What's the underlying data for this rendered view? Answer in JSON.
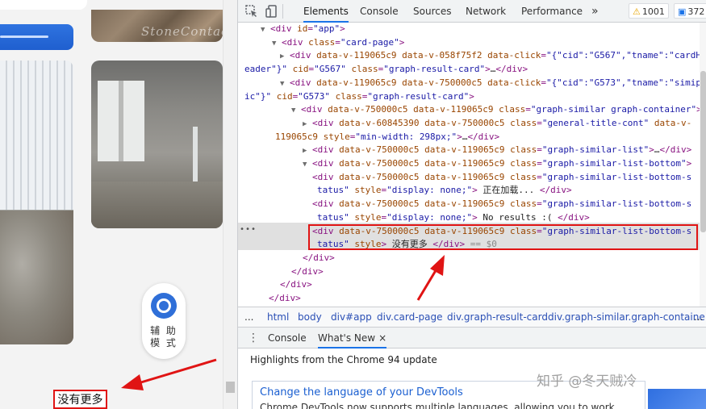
{
  "page": {
    "watermark_top": "StoneContact",
    "assist_label": "辅 助\n模 式",
    "no_more": "没有更多"
  },
  "devtools": {
    "tabs": [
      "Elements",
      "Console",
      "Sources",
      "Network",
      "Performance"
    ],
    "more_tabs": "»",
    "warnings": "1001",
    "messages": "372",
    "crumbs": [
      "...",
      "html",
      "body",
      "div#app",
      "div.card-page",
      "div.graph-result-card",
      "div.graph-similar.graph-containe",
      "..."
    ],
    "drawer_tabs": [
      "Console",
      "What's New"
    ],
    "drawer_close": "×",
    "highlights": "Highlights from the Chrome 94 update",
    "card_title": "Change the language of your DevTools",
    "card_desc": "Chrome DevTools now supports multiple languages, allowing you to work",
    "watermark": "知乎 @冬天贼冷"
  },
  "dom_lines": [
    {
      "tri": "▼",
      "html": "<span class=\"tag\">&lt;div</span> <span class=\"an\">id</span>=<span class=\"av\">\"app\"</span><span class=\"tag\">&gt;</span>"
    },
    {
      "tri": "▼",
      "html": "<span class=\"tag\">&lt;div</span> <span class=\"an\">class</span>=<span class=\"av\">\"card-page\"</span><span class=\"tag\">&gt;</span>"
    },
    {
      "tri": "▶",
      "html": "<span class=\"tag\">&lt;div</span> <span class=\"an\">data-v-119065c9 data-v-058f75f2 data-click</span>=<span class=\"av\">\"{\"cid\":\"G567\",\"tname\":\"cardH</span>"
    },
    {
      "tri": "",
      "html": "<span class=\"av\">eader\"}\"</span> <span class=\"an\">cid</span>=<span class=\"av\">\"G567\"</span> <span class=\"an\">class</span>=<span class=\"av\">\"graph-result-card\"</span><span class=\"tag\">&gt;</span><span class=\"tx\">…</span><span class=\"tag\">&lt;/div&gt;</span>"
    },
    {
      "tri": "▼",
      "html": "<span class=\"tag\">&lt;div</span> <span class=\"an\">data-v-119065c9 data-v-750000c5 data-click</span>=<span class=\"av\">\"{\"cid\":\"G573\",\"tname\":\"simip</span>"
    },
    {
      "tri": "",
      "html": "<span class=\"av\">ic\"}\"</span> <span class=\"an\">cid</span>=<span class=\"av\">\"G573\"</span> <span class=\"an\">class</span>=<span class=\"av\">\"graph-result-card\"</span><span class=\"tag\">&gt;</span>"
    },
    {
      "tri": "▼",
      "html": "<span class=\"tag\">&lt;div</span> <span class=\"an\">data-v-750000c5 data-v-119065c9 class</span>=<span class=\"av\">\"graph-similar graph-container\"</span><span class=\"tag\">&gt;</span>"
    },
    {
      "tri": "▶",
      "html": "<span class=\"tag\">&lt;div</span> <span class=\"an\">data-v-60845390 data-v-750000c5 class</span>=<span class=\"av\">\"general-title-cont\"</span> <span class=\"an\">data-v-</span>"
    },
    {
      "tri": "",
      "html": "<span class=\"an\">119065c9 style</span>=<span class=\"av\">\"min-width: 298px;\"</span><span class=\"tag\">&gt;</span><span class=\"tx\">…</span><span class=\"tag\">&lt;/div&gt;</span>"
    },
    {
      "tri": "▶",
      "html": "<span class=\"tag\">&lt;div</span> <span class=\"an\">data-v-750000c5 data-v-119065c9 class</span>=<span class=\"av\">\"graph-similar-list\"</span><span class=\"tag\">&gt;</span><span class=\"tx\">…</span><span class=\"tag\">&lt;/div&gt;</span>"
    },
    {
      "tri": "▼",
      "html": "<span class=\"tag\">&lt;div</span> <span class=\"an\">data-v-750000c5 data-v-119065c9 class</span>=<span class=\"av\">\"graph-similar-list-bottom\"</span><span class=\"tag\">&gt;</span>"
    },
    {
      "tri": "",
      "html": "<span class=\"tag\">&lt;div</span> <span class=\"an\">data-v-750000c5 data-v-119065c9 class</span>=<span class=\"av\">\"graph-similar-list-bottom-s</span>"
    },
    {
      "tri": "",
      "html": "<span class=\"av\">tatus\"</span> <span class=\"an\">style</span>=<span class=\"av\">\"display: none;\"</span><span class=\"tag\">&gt;</span> <span class=\"tx\">正在加载... </span><span class=\"tag\">&lt;/div&gt;</span>"
    },
    {
      "tri": "",
      "html": "<span class=\"tag\">&lt;div</span> <span class=\"an\">data-v-750000c5 data-v-119065c9 class</span>=<span class=\"av\">\"graph-similar-list-bottom-s</span>"
    },
    {
      "tri": "",
      "html": "<span class=\"av\">tatus\"</span> <span class=\"an\">style</span>=<span class=\"av\">\"display: none;\"</span><span class=\"tag\">&gt;</span> <span class=\"tx\">No results :( </span><span class=\"tag\">&lt;/div&gt;</span>"
    },
    {
      "tri": "",
      "html": "<span class=\"tag\">&lt;div</span> <span class=\"an\">data-v-750000c5 data-v-119065c9 class</span>=<span class=\"av\">\"graph-similar-list-bottom-s</span>"
    },
    {
      "tri": "",
      "html": "<span class=\"av\">tatus\"</span> <span class=\"an\">style</span><span class=\"tag\">&gt;</span> <span class=\"tx\">没有更多 </span><span class=\"tag\">&lt;/div&gt;</span> <span class=\"cm\">== $0</span>"
    },
    {
      "tri": "",
      "html": "<span class=\"tag\">&lt;/div&gt;</span>"
    },
    {
      "tri": "",
      "html": "<span class=\"tag\">&lt;/div&gt;</span>"
    },
    {
      "tri": "",
      "html": "<span class=\"tag\">&lt;/div&gt;</span>"
    },
    {
      "tri": "",
      "html": "<span class=\"tag\">&lt;/div&gt;</span>"
    }
  ]
}
